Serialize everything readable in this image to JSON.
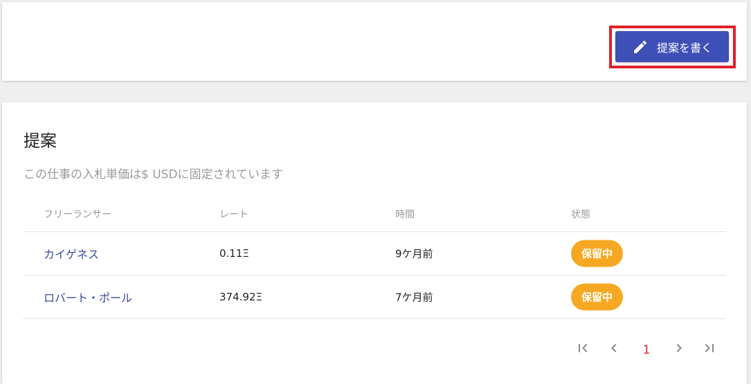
{
  "header": {
    "write_proposal_label": "提案を書く",
    "write_icon": "pencil-icon"
  },
  "section": {
    "title": "提案",
    "subtitle": "この仕事の入札単価は$ USDに固定されています"
  },
  "table": {
    "columns": [
      "フリーランサー",
      "レート",
      "時間",
      "状態"
    ],
    "rows": [
      {
        "freelancer": "カイゲネス",
        "rate": "0.11Ξ",
        "time": "9ケ月前",
        "status": "保留中"
      },
      {
        "freelancer": "ロバート・ポール",
        "rate": "374.92Ξ",
        "time": "7ケ月前",
        "status": "保留中"
      }
    ]
  },
  "pagination": {
    "current_page": "1"
  },
  "colors": {
    "accent": "#3f4fb8",
    "highlight": "#e0202c",
    "pending": "#f7a823",
    "link": "#3a4a99"
  }
}
